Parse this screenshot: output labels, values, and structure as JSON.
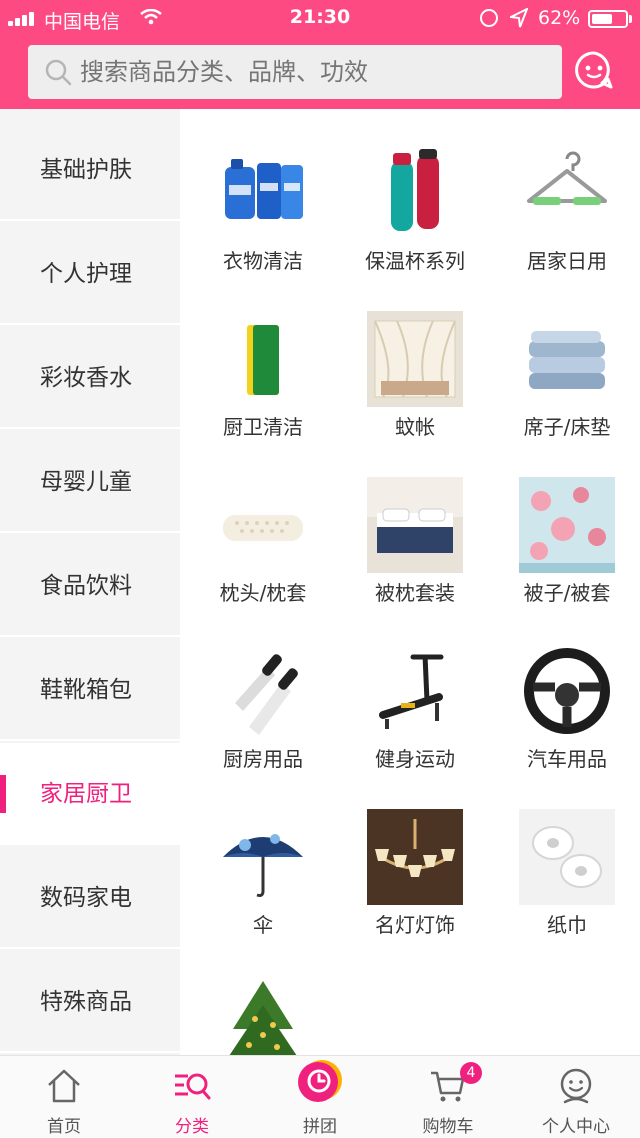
{
  "status_bar": {
    "carrier": "中国电信",
    "time": "21:30",
    "battery": "62%",
    "battery_level": 0.62
  },
  "search": {
    "placeholder": "搜索商品分类、品牌、功效"
  },
  "categories": [
    {
      "label": "基础护肤",
      "active": false
    },
    {
      "label": "个人护理",
      "active": false
    },
    {
      "label": "彩妆香水",
      "active": false
    },
    {
      "label": "母婴儿童",
      "active": false
    },
    {
      "label": "食品饮料",
      "active": false
    },
    {
      "label": "鞋靴箱包",
      "active": false
    },
    {
      "label": "家居厨卫",
      "active": true
    },
    {
      "label": "数码家电",
      "active": false
    },
    {
      "label": "特殊商品",
      "active": false
    }
  ],
  "items": [
    {
      "label": "衣物清洁",
      "icon": "laundry-detergent"
    },
    {
      "label": "保温杯系列",
      "icon": "thermos-bottles"
    },
    {
      "label": "居家日用",
      "icon": "clothes-hanger"
    },
    {
      "label": "厨卫清洁",
      "icon": "scrub-sponge"
    },
    {
      "label": "蚊帐",
      "icon": "mosquito-net"
    },
    {
      "label": "席子/床垫",
      "icon": "folded-mat"
    },
    {
      "label": "枕头/枕套",
      "icon": "latex-pillow"
    },
    {
      "label": "被枕套装",
      "icon": "bedding-set"
    },
    {
      "label": "被子/被套",
      "icon": "floral-quilt"
    },
    {
      "label": "厨房用品",
      "icon": "kitchen-knives"
    },
    {
      "label": "健身运动",
      "icon": "exercise-bench"
    },
    {
      "label": "汽车用品",
      "icon": "steering-wheel"
    },
    {
      "label": "伞",
      "icon": "umbrella"
    },
    {
      "label": "名灯灯饰",
      "icon": "chandelier"
    },
    {
      "label": "纸巾",
      "icon": "tissue-rolls"
    },
    {
      "label": "",
      "icon": "christmas-tree"
    }
  ],
  "tabs": [
    {
      "label": "首页",
      "icon": "home-icon"
    },
    {
      "label": "分类",
      "icon": "category-icon",
      "active": true
    },
    {
      "label": "拼团",
      "icon": "group-buy-icon"
    },
    {
      "label": "购物车",
      "icon": "cart-icon",
      "badge": "4"
    },
    {
      "label": "个人中心",
      "icon": "profile-icon"
    }
  ],
  "colors": {
    "brand": "#fd4a82",
    "accent": "#f0207f"
  }
}
